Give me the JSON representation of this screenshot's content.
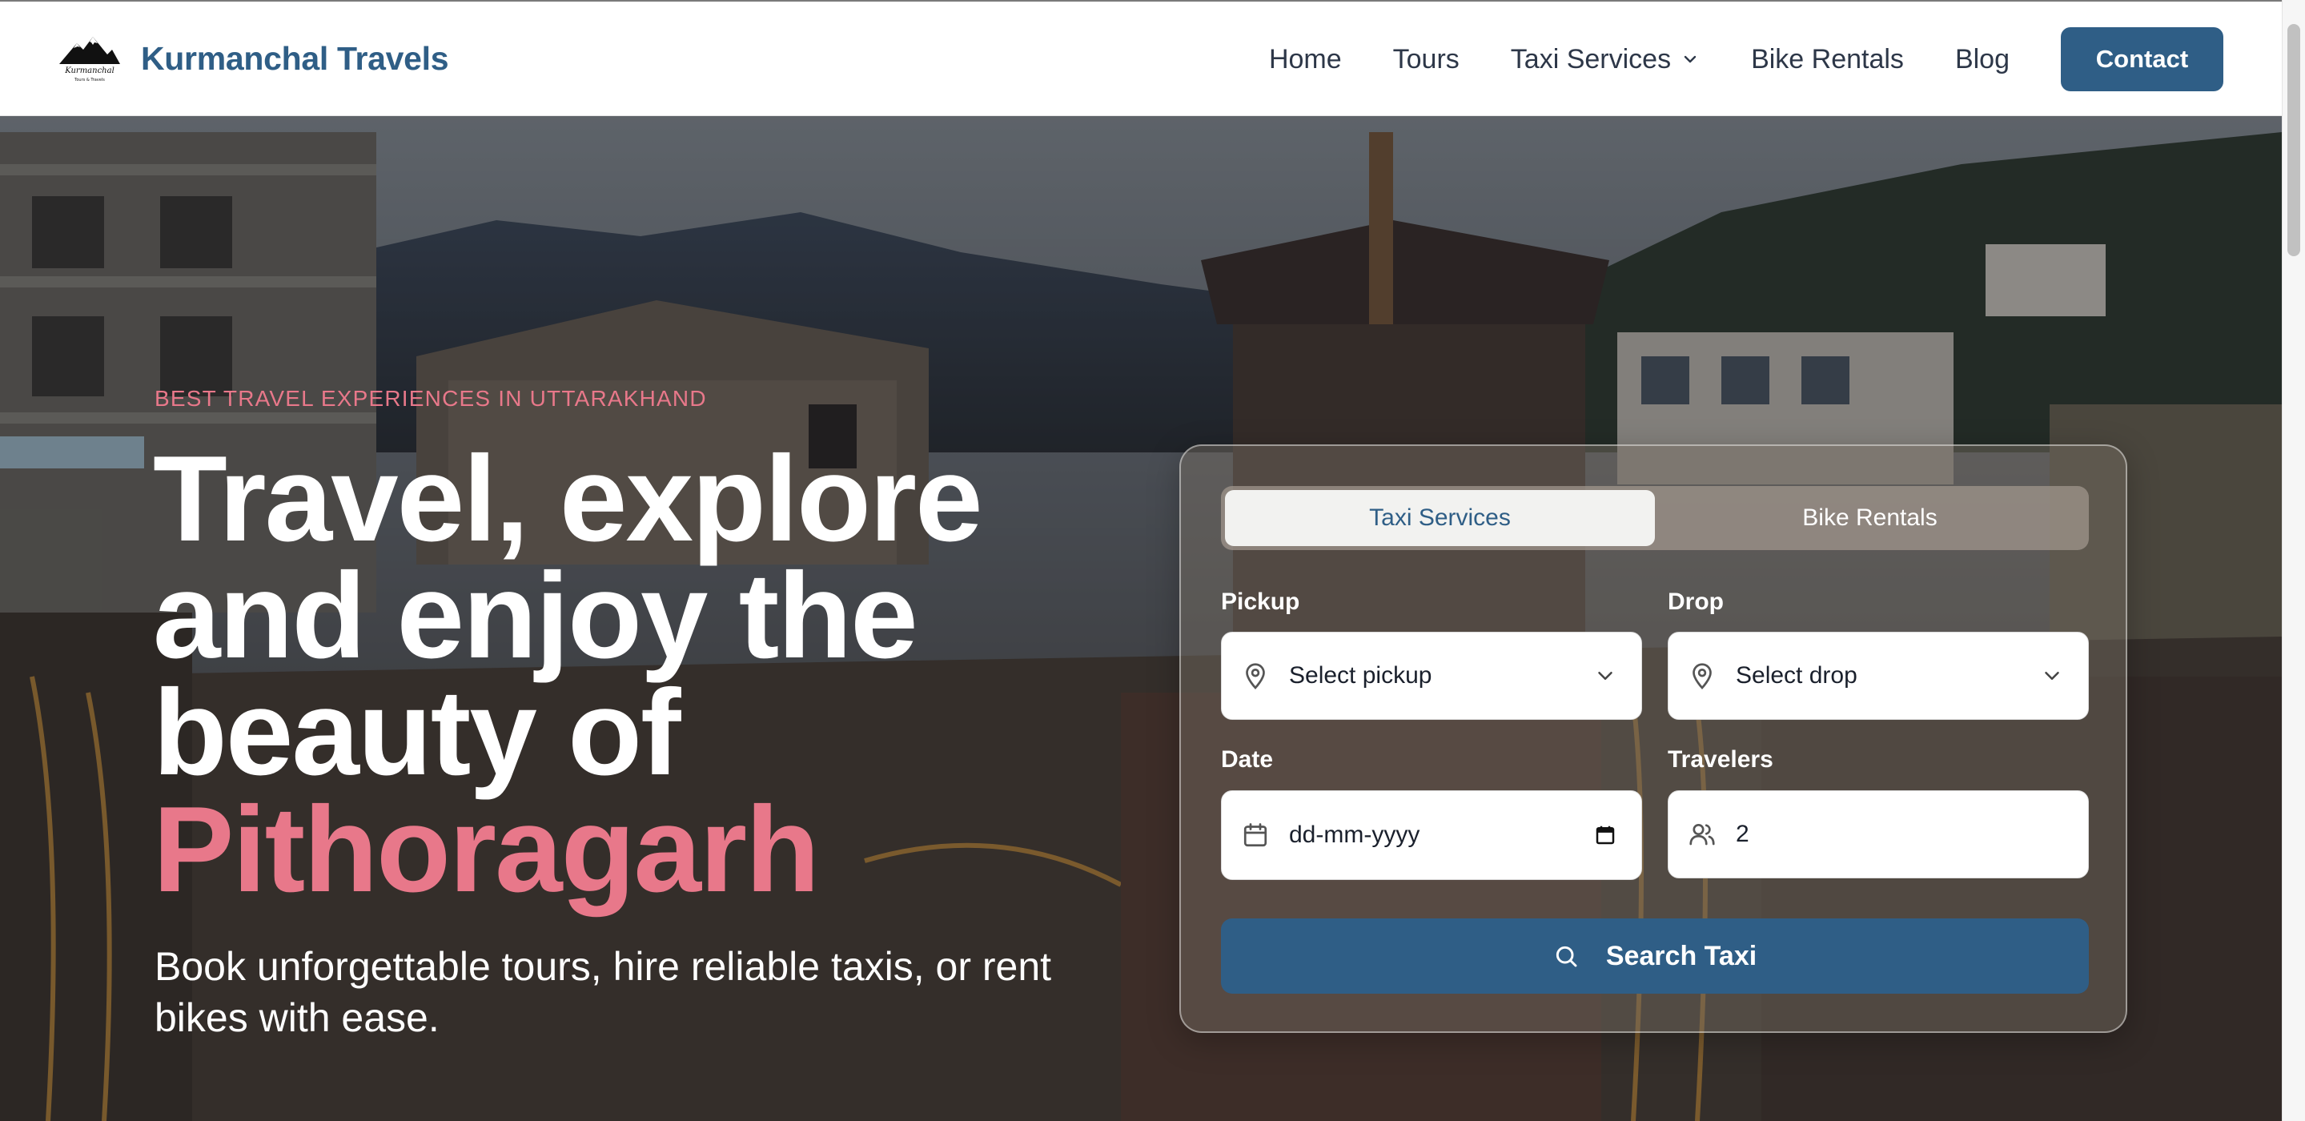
{
  "brand": {
    "name": "Kurmanchal Travels",
    "logo_text": "Kurmanchal",
    "logo_subtext": "Tours & Travels",
    "color": "#2f5e86"
  },
  "nav": {
    "items": [
      {
        "label": "Home"
      },
      {
        "label": "Tours"
      },
      {
        "label": "Taxi Services",
        "has_dropdown": true
      },
      {
        "label": "Bike Rentals"
      },
      {
        "label": "Blog"
      }
    ],
    "contact_label": "Contact"
  },
  "hero": {
    "kicker": "BEST TRAVEL EXPERIENCES IN UTTARAKHAND",
    "headline_lines": [
      "Travel, explore",
      "and enjoy the",
      "beauty of"
    ],
    "headline_accent": "Pithoragarh",
    "subtitle": "Book unforgettable tours, hire reliable taxis, or rent bikes with ease.",
    "accent_color": "#e8788a"
  },
  "booking": {
    "tabs": [
      {
        "label": "Taxi Services",
        "active": true
      },
      {
        "label": "Bike Rentals",
        "active": false
      }
    ],
    "pickup": {
      "label": "Pickup",
      "placeholder": "Select pickup",
      "icon": "map-pin-icon"
    },
    "drop": {
      "label": "Drop",
      "placeholder": "Select drop",
      "icon": "map-pin-icon"
    },
    "date": {
      "label": "Date",
      "placeholder": "dd-mm-yyyy",
      "icon": "calendar-icon"
    },
    "travelers": {
      "label": "Travelers",
      "value": "2",
      "icon": "users-icon"
    },
    "submit_label": "Search Taxi"
  }
}
